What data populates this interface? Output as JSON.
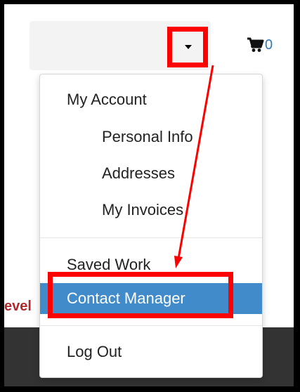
{
  "header": {
    "cart_count": "0",
    "cart_icon": "shopping-cart-icon",
    "dropdown_icon": "caret-down-icon"
  },
  "background": {
    "cut_text": "evel"
  },
  "menu": {
    "my_account": "My Account",
    "personal_info": "Personal Info",
    "addresses": "Addresses",
    "my_invoices": "My Invoices",
    "saved_work": "Saved Work",
    "contact_manager": "Contact Manager",
    "log_out": "Log Out"
  },
  "colors": {
    "annotation": "#ff0000",
    "active_item_bg": "#428bca",
    "link": "#337ab7",
    "footer": "#333333"
  }
}
